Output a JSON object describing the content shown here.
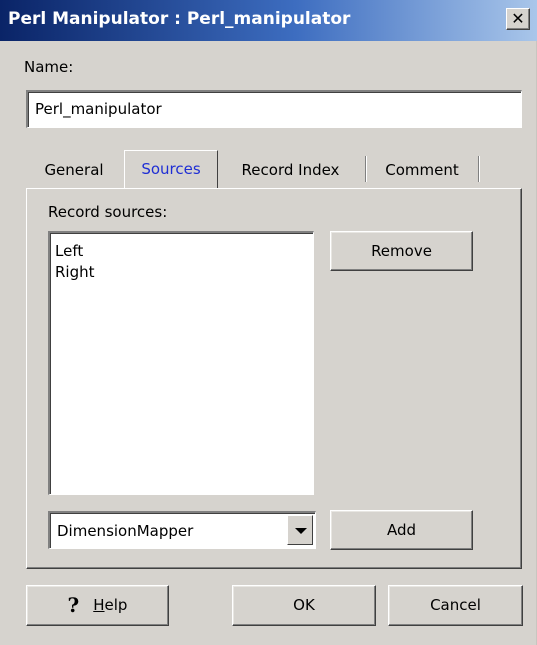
{
  "window": {
    "title": "Perl Manipulator : Perl_manipulator",
    "close_symbol": "✕"
  },
  "name": {
    "label": "Name:",
    "value": "Perl_manipulator"
  },
  "tabs": [
    {
      "label": "General",
      "selected": false
    },
    {
      "label": "Sources",
      "selected": true
    },
    {
      "label": "Record Index",
      "selected": false
    },
    {
      "label": "Comment",
      "selected": false
    }
  ],
  "sources": {
    "label": "Record sources:",
    "items": [
      "Left",
      "Right"
    ],
    "remove_button": "Remove",
    "dropdown_value": "DimensionMapper",
    "add_button": "Add"
  },
  "footer": {
    "help_icon": "help-icon",
    "help_label_underlined": "H",
    "help_label_rest": "elp",
    "ok_label": "OK",
    "cancel_label": "Cancel"
  },
  "colors": {
    "dialog_bg": "#d6d3ce",
    "title_gradient_start": "#0a2467",
    "title_gradient_end": "#a9c6ea",
    "selected_tab_text": "#1f2ed4"
  }
}
